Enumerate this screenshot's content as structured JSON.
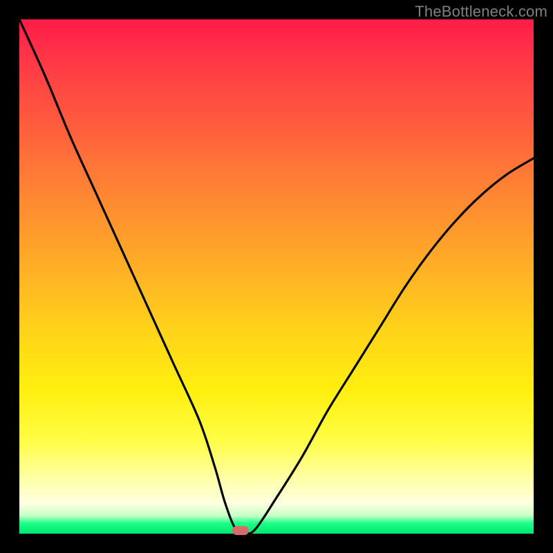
{
  "watermark": "TheBottleneck.com",
  "colors": {
    "frame": "#000000",
    "curve": "#000000",
    "marker": "#d76a6a",
    "gradient_top": "#ff1b49",
    "gradient_bottom": "#00e86f"
  },
  "chart_data": {
    "type": "line",
    "title": "",
    "xlabel": "",
    "ylabel": "",
    "xlim": [
      0,
      100
    ],
    "ylim": [
      0,
      100
    ],
    "series": [
      {
        "name": "bottleneck-curve",
        "x": [
          0,
          5,
          10,
          15,
          20,
          25,
          30,
          35,
          38,
          40,
          42,
          44,
          46,
          50,
          55,
          60,
          65,
          70,
          75,
          80,
          85,
          90,
          95,
          100
        ],
        "y": [
          100,
          89,
          77,
          66,
          55,
          44,
          33,
          22,
          13,
          6,
          1,
          0,
          1,
          7,
          15,
          24,
          32,
          40,
          48,
          55,
          61,
          66,
          70,
          73
        ]
      }
    ],
    "marker": {
      "x": 43,
      "y": 0
    },
    "legend": false,
    "grid": false
  }
}
